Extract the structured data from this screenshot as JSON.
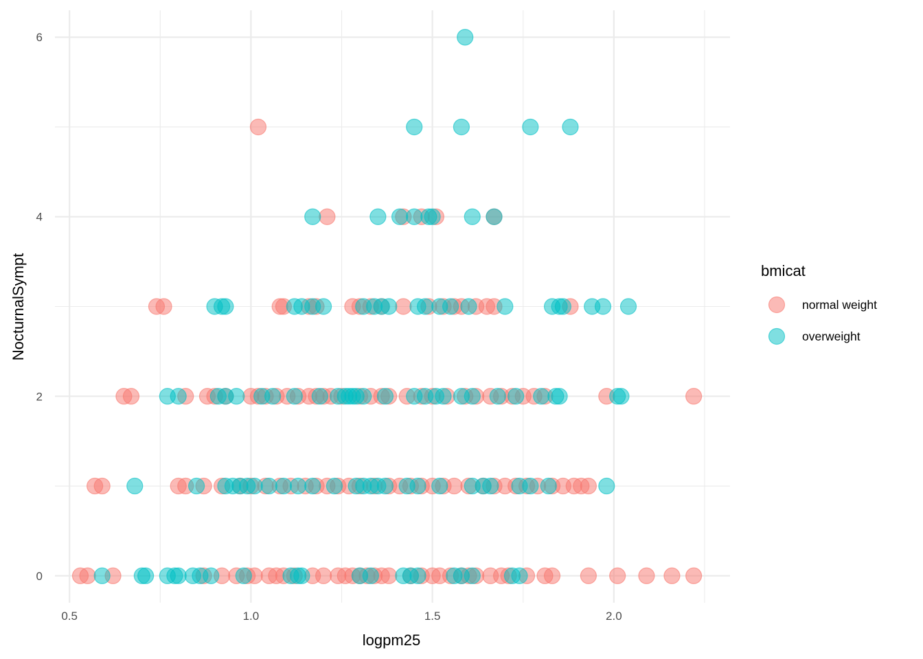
{
  "chart_data": {
    "type": "scatter",
    "title": "",
    "xlabel": "logpm25",
    "ylabel": "NocturnalSympt",
    "xlim": [
      0.46,
      2.32
    ],
    "ylim": [
      -0.3,
      6.3
    ],
    "x_ticks": [
      0.5,
      1.0,
      1.5,
      2.0
    ],
    "x_tick_labels": [
      "0.5",
      "1.0",
      "1.5",
      "2.0"
    ],
    "y_ticks": [
      0,
      2,
      4,
      6
    ],
    "y_tick_labels": [
      "0",
      "2",
      "4",
      "6"
    ],
    "x_minor_ticks": [
      0.75,
      1.25,
      1.75,
      2.25
    ],
    "y_minor_ticks": [
      1,
      3,
      5
    ],
    "grid": true,
    "legend": {
      "title": "bmicat",
      "placement": "right",
      "entries": [
        {
          "label": "normal weight",
          "color": "#F8766D"
        },
        {
          "label": "overweight",
          "color": "#00BFC4"
        }
      ]
    },
    "point_alpha": 0.5,
    "series": [
      {
        "name": "normal weight",
        "color": "#F8766D",
        "points": [
          [
            1.02,
            5
          ],
          [
            1.21,
            4
          ],
          [
            1.42,
            4
          ],
          [
            1.47,
            4
          ],
          [
            1.51,
            4
          ],
          [
            1.67,
            4
          ],
          [
            0.74,
            3
          ],
          [
            0.76,
            3
          ],
          [
            1.08,
            3
          ],
          [
            1.09,
            3
          ],
          [
            1.16,
            3
          ],
          [
            1.18,
            3
          ],
          [
            1.28,
            3
          ],
          [
            1.3,
            3
          ],
          [
            1.33,
            3
          ],
          [
            1.36,
            3
          ],
          [
            1.42,
            3
          ],
          [
            1.49,
            3
          ],
          [
            1.53,
            3
          ],
          [
            1.56,
            3
          ],
          [
            1.58,
            3
          ],
          [
            1.62,
            3
          ],
          [
            1.65,
            3
          ],
          [
            1.67,
            3
          ],
          [
            1.88,
            3
          ],
          [
            0.65,
            2
          ],
          [
            0.67,
            2
          ],
          [
            0.82,
            2
          ],
          [
            0.88,
            2
          ],
          [
            0.9,
            2
          ],
          [
            0.93,
            2
          ],
          [
            1.0,
            2
          ],
          [
            1.02,
            2
          ],
          [
            1.04,
            2
          ],
          [
            1.07,
            2
          ],
          [
            1.1,
            2
          ],
          [
            1.13,
            2
          ],
          [
            1.16,
            2
          ],
          [
            1.18,
            2
          ],
          [
            1.2,
            2
          ],
          [
            1.22,
            2
          ],
          [
            1.25,
            2
          ],
          [
            1.3,
            2
          ],
          [
            1.33,
            2
          ],
          [
            1.36,
            2
          ],
          [
            1.38,
            2
          ],
          [
            1.43,
            2
          ],
          [
            1.47,
            2
          ],
          [
            1.5,
            2
          ],
          [
            1.54,
            2
          ],
          [
            1.59,
            2
          ],
          [
            1.62,
            2
          ],
          [
            1.66,
            2
          ],
          [
            1.69,
            2
          ],
          [
            1.72,
            2
          ],
          [
            1.75,
            2
          ],
          [
            1.78,
            2
          ],
          [
            1.81,
            2
          ],
          [
            1.98,
            2
          ],
          [
            2.22,
            2
          ],
          [
            0.57,
            1
          ],
          [
            0.59,
            1
          ],
          [
            0.8,
            1
          ],
          [
            0.82,
            1
          ],
          [
            0.87,
            1
          ],
          [
            0.92,
            1
          ],
          [
            0.97,
            1
          ],
          [
            1.0,
            1
          ],
          [
            1.04,
            1
          ],
          [
            1.08,
            1
          ],
          [
            1.11,
            1
          ],
          [
            1.15,
            1
          ],
          [
            1.18,
            1
          ],
          [
            1.21,
            1
          ],
          [
            1.24,
            1
          ],
          [
            1.27,
            1
          ],
          [
            1.3,
            1
          ],
          [
            1.34,
            1
          ],
          [
            1.38,
            1
          ],
          [
            1.41,
            1
          ],
          [
            1.44,
            1
          ],
          [
            1.47,
            1
          ],
          [
            1.5,
            1
          ],
          [
            1.53,
            1
          ],
          [
            1.56,
            1
          ],
          [
            1.6,
            1
          ],
          [
            1.64,
            1
          ],
          [
            1.67,
            1
          ],
          [
            1.7,
            1
          ],
          [
            1.73,
            1
          ],
          [
            1.76,
            1
          ],
          [
            1.79,
            1
          ],
          [
            1.83,
            1
          ],
          [
            1.86,
            1
          ],
          [
            1.89,
            1
          ],
          [
            1.91,
            1
          ],
          [
            1.93,
            1
          ],
          [
            0.53,
            0
          ],
          [
            0.55,
            0
          ],
          [
            0.62,
            0
          ],
          [
            0.87,
            0
          ],
          [
            0.92,
            0
          ],
          [
            0.96,
            0
          ],
          [
            0.99,
            0
          ],
          [
            1.01,
            0
          ],
          [
            1.05,
            0
          ],
          [
            1.07,
            0
          ],
          [
            1.09,
            0
          ],
          [
            1.12,
            0
          ],
          [
            1.17,
            0
          ],
          [
            1.2,
            0
          ],
          [
            1.24,
            0
          ],
          [
            1.26,
            0
          ],
          [
            1.28,
            0
          ],
          [
            1.3,
            0
          ],
          [
            1.32,
            0
          ],
          [
            1.34,
            0
          ],
          [
            1.36,
            0
          ],
          [
            1.38,
            0
          ],
          [
            1.44,
            0
          ],
          [
            1.47,
            0
          ],
          [
            1.5,
            0
          ],
          [
            1.52,
            0
          ],
          [
            1.55,
            0
          ],
          [
            1.58,
            0
          ],
          [
            1.6,
            0
          ],
          [
            1.62,
            0
          ],
          [
            1.66,
            0
          ],
          [
            1.69,
            0
          ],
          [
            1.71,
            0
          ],
          [
            1.76,
            0
          ],
          [
            1.81,
            0
          ],
          [
            1.83,
            0
          ],
          [
            1.93,
            0
          ],
          [
            2.01,
            0
          ],
          [
            2.09,
            0
          ],
          [
            2.16,
            0
          ],
          [
            2.22,
            0
          ]
        ]
      },
      {
        "name": "overweight",
        "color": "#00BFC4",
        "points": [
          [
            1.59,
            6
          ],
          [
            1.45,
            5
          ],
          [
            1.58,
            5
          ],
          [
            1.77,
            5
          ],
          [
            1.88,
            5
          ],
          [
            1.17,
            4
          ],
          [
            1.35,
            4
          ],
          [
            1.41,
            4
          ],
          [
            1.45,
            4
          ],
          [
            1.49,
            4
          ],
          [
            1.5,
            4
          ],
          [
            1.61,
            4
          ],
          [
            1.67,
            4
          ],
          [
            0.9,
            3
          ],
          [
            0.92,
            3
          ],
          [
            0.93,
            3
          ],
          [
            1.12,
            3
          ],
          [
            1.14,
            3
          ],
          [
            1.17,
            3
          ],
          [
            1.2,
            3
          ],
          [
            1.31,
            3
          ],
          [
            1.34,
            3
          ],
          [
            1.36,
            3
          ],
          [
            1.38,
            3
          ],
          [
            1.46,
            3
          ],
          [
            1.48,
            3
          ],
          [
            1.52,
            3
          ],
          [
            1.55,
            3
          ],
          [
            1.6,
            3
          ],
          [
            1.7,
            3
          ],
          [
            1.83,
            3
          ],
          [
            1.85,
            3
          ],
          [
            1.86,
            3
          ],
          [
            1.94,
            3
          ],
          [
            1.97,
            3
          ],
          [
            2.04,
            3
          ],
          [
            0.77,
            2
          ],
          [
            0.8,
            2
          ],
          [
            0.91,
            2
          ],
          [
            0.93,
            2
          ],
          [
            0.96,
            2
          ],
          [
            1.03,
            2
          ],
          [
            1.06,
            2
          ],
          [
            1.12,
            2
          ],
          [
            1.19,
            2
          ],
          [
            1.24,
            2
          ],
          [
            1.26,
            2
          ],
          [
            1.27,
            2
          ],
          [
            1.28,
            2
          ],
          [
            1.29,
            2
          ],
          [
            1.31,
            2
          ],
          [
            1.37,
            2
          ],
          [
            1.45,
            2
          ],
          [
            1.48,
            2
          ],
          [
            1.51,
            2
          ],
          [
            1.53,
            2
          ],
          [
            1.58,
            2
          ],
          [
            1.61,
            2
          ],
          [
            1.68,
            2
          ],
          [
            1.73,
            2
          ],
          [
            1.8,
            2
          ],
          [
            1.84,
            2
          ],
          [
            1.85,
            2
          ],
          [
            2.01,
            2
          ],
          [
            2.02,
            2
          ],
          [
            0.68,
            1
          ],
          [
            0.85,
            1
          ],
          [
            0.93,
            1
          ],
          [
            0.95,
            1
          ],
          [
            0.97,
            1
          ],
          [
            0.99,
            1
          ],
          [
            1.01,
            1
          ],
          [
            1.05,
            1
          ],
          [
            1.09,
            1
          ],
          [
            1.13,
            1
          ],
          [
            1.17,
            1
          ],
          [
            1.23,
            1
          ],
          [
            1.29,
            1
          ],
          [
            1.31,
            1
          ],
          [
            1.33,
            1
          ],
          [
            1.35,
            1
          ],
          [
            1.37,
            1
          ],
          [
            1.43,
            1
          ],
          [
            1.46,
            1
          ],
          [
            1.52,
            1
          ],
          [
            1.61,
            1
          ],
          [
            1.64,
            1
          ],
          [
            1.66,
            1
          ],
          [
            1.74,
            1
          ],
          [
            1.77,
            1
          ],
          [
            1.82,
            1
          ],
          [
            1.98,
            1
          ],
          [
            0.59,
            0
          ],
          [
            0.7,
            0
          ],
          [
            0.71,
            0
          ],
          [
            0.77,
            0
          ],
          [
            0.79,
            0
          ],
          [
            0.8,
            0
          ],
          [
            0.84,
            0
          ],
          [
            0.86,
            0
          ],
          [
            0.89,
            0
          ],
          [
            0.98,
            0
          ],
          [
            1.11,
            0
          ],
          [
            1.13,
            0
          ],
          [
            1.14,
            0
          ],
          [
            1.3,
            0
          ],
          [
            1.33,
            0
          ],
          [
            1.42,
            0
          ],
          [
            1.44,
            0
          ],
          [
            1.46,
            0
          ],
          [
            1.56,
            0
          ],
          [
            1.58,
            0
          ],
          [
            1.61,
            0
          ],
          [
            1.72,
            0
          ],
          [
            1.74,
            0
          ]
        ]
      }
    ]
  }
}
